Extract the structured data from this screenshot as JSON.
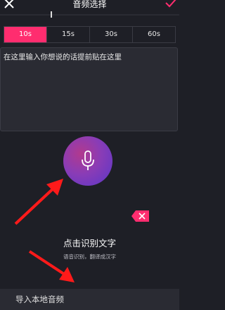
{
  "header": {
    "title": "音频选择",
    "close_icon": "close-icon",
    "confirm_icon": "checkmark-icon"
  },
  "duration_tabs": [
    {
      "label": "10s",
      "active": true
    },
    {
      "label": "15s",
      "active": false
    },
    {
      "label": "30s",
      "active": false
    },
    {
      "label": "60s",
      "active": false
    }
  ],
  "text_input": {
    "value": "在这里输入你想说的话提前贴在这里"
  },
  "record": {
    "icon": "microphone-icon",
    "hint": "点击识别文字",
    "sub_hint": "语音识别，翻译成汉字"
  },
  "delete_icon": "backspace-icon",
  "bottom": {
    "import_label": "导入本地音频"
  },
  "colors": {
    "accent": "#ff2d6f",
    "background": "#1e1f26",
    "panel": "#2a2b33"
  }
}
